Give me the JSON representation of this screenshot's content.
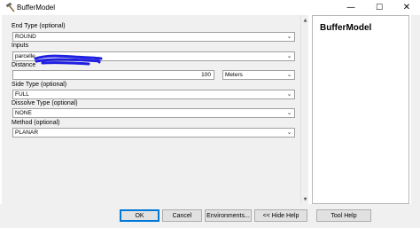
{
  "window": {
    "title": "BufferModel"
  },
  "form": {
    "end_type_label": "End Type (optional)",
    "end_type_value": "ROUND",
    "inputs_label": "Inputs",
    "inputs_value": "parcelle",
    "distance_label": "Distance",
    "distance_value": "100",
    "distance_unit": "Meters",
    "side_type_label": "Side Type (optional)",
    "side_type_value": "FULL",
    "dissolve_type_label": "Dissolve Type (optional)",
    "dissolve_type_value": "NONE",
    "method_label": "Method (optional)",
    "method_value": "PLANAR"
  },
  "help": {
    "title": "BufferModel"
  },
  "buttons": {
    "ok": "OK",
    "cancel": "Cancel",
    "environments": "Environments...",
    "hide_help": "<< Hide Help",
    "tool_help": "Tool Help"
  },
  "colors": {
    "redaction": "#1f1fe0",
    "dialog_bg": "#f0f0f0",
    "default_button_border": "#0078d7"
  }
}
